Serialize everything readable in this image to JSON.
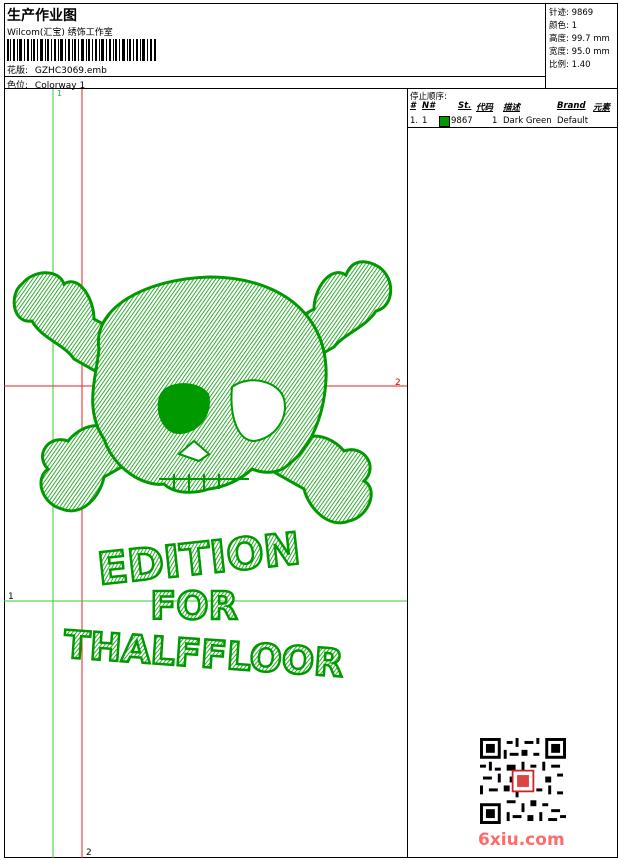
{
  "header": {
    "title": "生产作业图",
    "company": "Wilcom(汇宝) 绣饰工作室",
    "design_label": "花版:",
    "design_value": "GZHC3069.emb",
    "colorway_label": "色位:",
    "colorway_value": "Colorway 1"
  },
  "specs": [
    {
      "label": "针迹:",
      "value": "9869"
    },
    {
      "label": "颜色:",
      "value": "1"
    },
    {
      "label": "高度:",
      "value": "99.7 mm"
    },
    {
      "label": "宽度:",
      "value": "95.0 mm"
    },
    {
      "label": "比例:",
      "value": "1.40"
    }
  ],
  "stop_sequence": {
    "title": "停止顺序:",
    "columns": [
      "#",
      "N#",
      "St.",
      "代码",
      "描述",
      "Brand",
      "元素"
    ],
    "rows": [
      {
        "index": "1.",
        "needle": "1",
        "code": "9867",
        "stitch_count": "1",
        "description": "Dark Green",
        "brand": "Default"
      }
    ]
  },
  "guides": {
    "v_green_label": "1",
    "v_red_label": "2",
    "h_red_label": "2",
    "h_green_label": "1"
  },
  "artwork": {
    "text_line1": "EDITION",
    "text_line2": "FOR",
    "text_line3": "THALFFLOOR"
  },
  "watermark": {
    "text": "6xiu.com"
  },
  "colors": {
    "thread": "#009900",
    "guide_green": "#33cc33",
    "guide_red": "#ee2222"
  }
}
